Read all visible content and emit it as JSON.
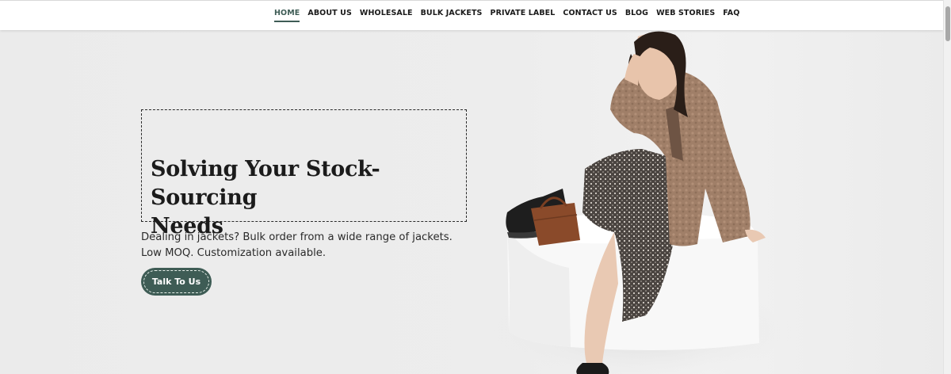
{
  "nav": {
    "items": [
      {
        "label": "HOME",
        "active": true
      },
      {
        "label": "ABOUT US",
        "active": false
      },
      {
        "label": "WHOLESALE",
        "active": false
      },
      {
        "label": "BULK JACKETS",
        "active": false
      },
      {
        "label": "PRIVATE LABEL",
        "active": false
      },
      {
        "label": "CONTACT US",
        "active": false
      },
      {
        "label": "BLOG",
        "active": false
      },
      {
        "label": "WEB STORIES",
        "active": false
      },
      {
        "label": "FAQ",
        "active": false
      }
    ]
  },
  "hero": {
    "headline_line1": "Solving Your Stock-Sourcing",
    "headline_line2": "Needs",
    "subtext": "Dealing in jackets? Bulk order from a wide range of jackets. Low MOQ. Customization available.",
    "cta_label": "Talk To Us"
  },
  "colors": {
    "accent": "#3e5c55",
    "background": "#ececec",
    "text": "#1b1b1b"
  }
}
